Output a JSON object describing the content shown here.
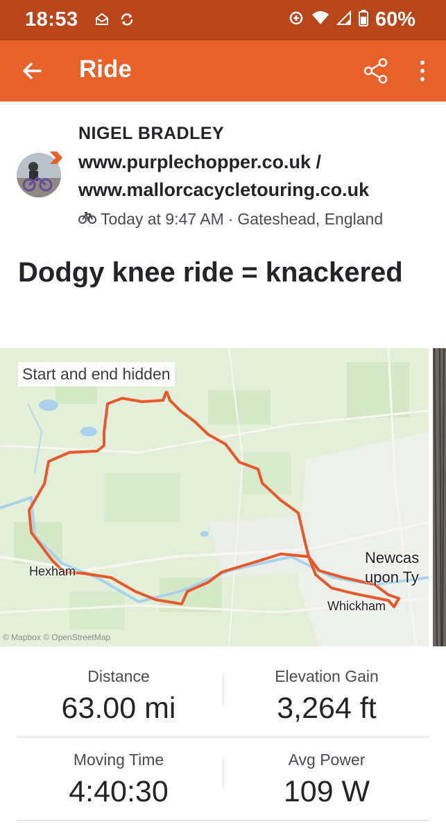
{
  "status_bar": {
    "time": "18:53",
    "battery": "60%",
    "icons": [
      "mail-icon",
      "sync-icon",
      "data-saver-icon",
      "wifi-icon",
      "signal-icon",
      "battery-icon"
    ]
  },
  "app_bar": {
    "title": "Ride",
    "icons": [
      "back-arrow-icon",
      "share-icon",
      "more-vertical-icon"
    ]
  },
  "athlete": {
    "name": "NIGEL BRADLEY",
    "line1": "www.purplechopper.co.uk /",
    "line2": "www.mallorcacycletouring.co.uk",
    "time": "Today at 9:47 AM",
    "separator": "·",
    "location": "Gateshead, England",
    "activity_icon": "bike-icon"
  },
  "activity": {
    "title": "Dodgy knee ride = knackered"
  },
  "map": {
    "privacy_label": "Start and end hidden",
    "places": {
      "hexham": "Hexham",
      "newcastle_1": "Newcas",
      "newcastle_2": "upon Ty",
      "whickham": "Whickham"
    },
    "attribution": "© Mapbox © OpenStreetMap",
    "route_color": "#e8582a"
  },
  "stats": [
    {
      "label": "Distance",
      "value": "63.00 mi"
    },
    {
      "label": "Elevation Gain",
      "value": "3,264 ft"
    },
    {
      "label": "Moving Time",
      "value": "4:40:30"
    },
    {
      "label": "Avg Power",
      "value": "109 W"
    }
  ],
  "colors": {
    "brand_orange": "#e8612b",
    "status_bar": "#b9461b"
  }
}
